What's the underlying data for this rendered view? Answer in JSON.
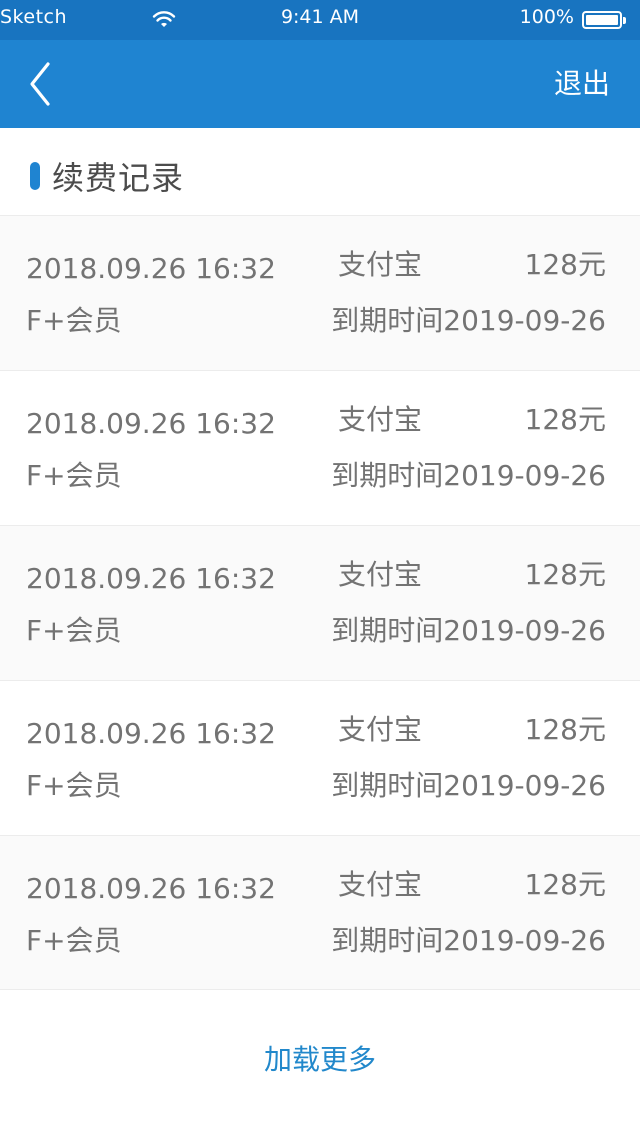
{
  "status_bar": {
    "carrier": "Sketch",
    "time": "9:41 AM",
    "battery": "100%",
    "wifi_icon": "wifi-icon",
    "battery_icon": "battery-icon"
  },
  "nav": {
    "back_icon": "chevron-left-icon",
    "logout_label": "退出",
    "colors": {
      "bar": "#1F84D1",
      "text": "#FFFFFF"
    }
  },
  "section": {
    "title": "续费记录",
    "accent_color": "#1F84D1",
    "title_color": "#4C4C4C"
  },
  "records": [
    {
      "datetime": "2018.09.26  16:32",
      "method": "支付宝",
      "amount": "128元",
      "plan": "F+会员",
      "expiry": "到期时间2019-09-26"
    },
    {
      "datetime": "2018.09.26  16:32",
      "method": "支付宝",
      "amount": "128元",
      "plan": "F+会员",
      "expiry": "到期时间2019-09-26"
    },
    {
      "datetime": "2018.09.26  16:32",
      "method": "支付宝",
      "amount": "128元",
      "plan": "F+会员",
      "expiry": "到期时间2019-09-26"
    },
    {
      "datetime": "2018.09.26  16:32",
      "method": "支付宝",
      "amount": "128元",
      "plan": "F+会员",
      "expiry": "到期时间2019-09-26"
    },
    {
      "datetime": "2018.09.26  16:32",
      "method": "支付宝",
      "amount": "128元",
      "plan": "F+会员",
      "expiry": "到期时间2019-09-26"
    }
  ],
  "colors": {
    "row_shade": "#FAFAFA",
    "row_border": "#ECECEC",
    "record_text": "#737373",
    "load_more": "#2288CB"
  },
  "load_more_label": "加载更多"
}
